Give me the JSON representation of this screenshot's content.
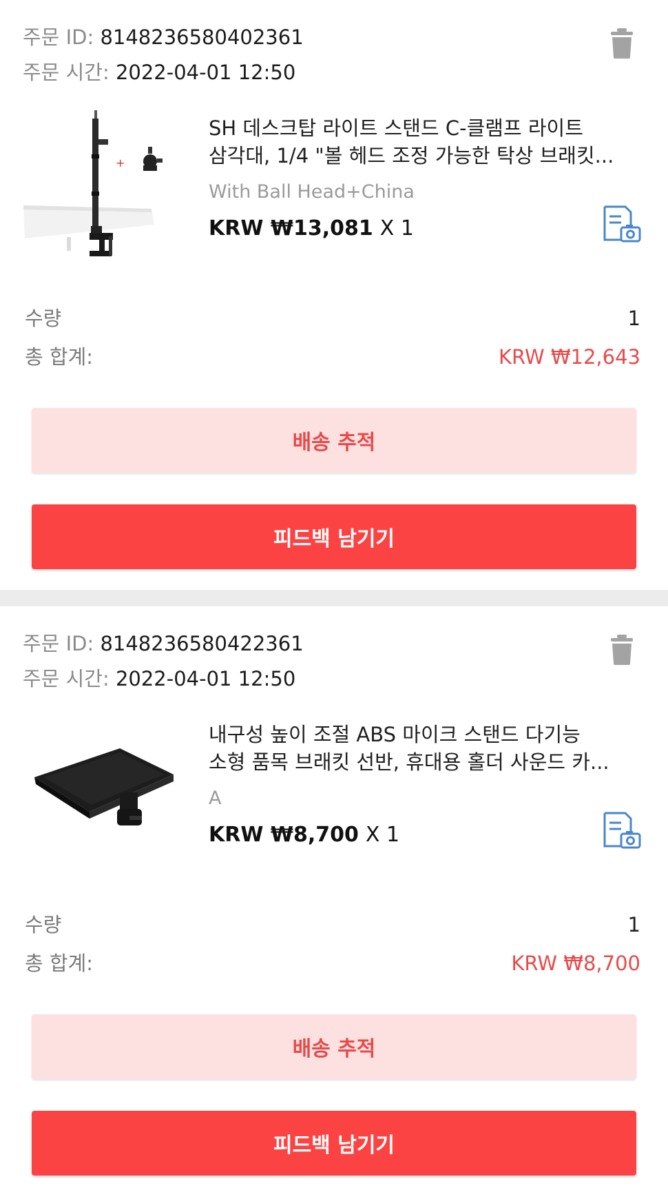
{
  "orders": [
    {
      "id_label": "주문 ID:",
      "id_value": "8148236580402361",
      "time_label": "주문 시간:",
      "time_value": "2022-04-01 12:50",
      "product_image": "light-stand-with-ball-head-image",
      "product_title_line1": "SH 데스크탑 라이트 스탠드 C-클램프 라이트",
      "product_title_line2": "삼각대, 1/4 \"볼 헤드 조정 가능한 탁상 브래킷...",
      "variant": "With Ball Head+China",
      "price": "KRW ₩13,081",
      "quantity_multiplier": "X 1",
      "quantity_label": "수량",
      "quantity_value": "1",
      "total_label": "총 합계:",
      "total_value": "KRW ₩12,643",
      "track_button": "배송 추적",
      "feedback_button": "피드백 남기기"
    },
    {
      "id_label": "주문 ID:",
      "id_value": "8148236580422361",
      "time_label": "주문 시간:",
      "time_value": "2022-04-01 12:50",
      "product_image": "mic-stand-tray-image",
      "product_title_line1": "내구성 높이 조절 ABS 마이크 스탠드 다기능",
      "product_title_line2": "소형 품목 브래킷 선반, 휴대용 홀더 사운드 카...",
      "variant": "A",
      "price": "KRW ₩8,700",
      "quantity_multiplier": "X 1",
      "quantity_label": "수량",
      "quantity_value": "1",
      "total_label": "총 합계:",
      "total_value": "KRW ₩8,700",
      "track_button": "배송 추적",
      "feedback_button": "피드백 남기기"
    }
  ],
  "colors": {
    "accent_red": "#fc4343",
    "accent_red_text": "#e84a4a",
    "track_button_bg": "#fde1e1",
    "icon_gray": "#9e9e9e",
    "icon_blue": "#4a86c8"
  }
}
